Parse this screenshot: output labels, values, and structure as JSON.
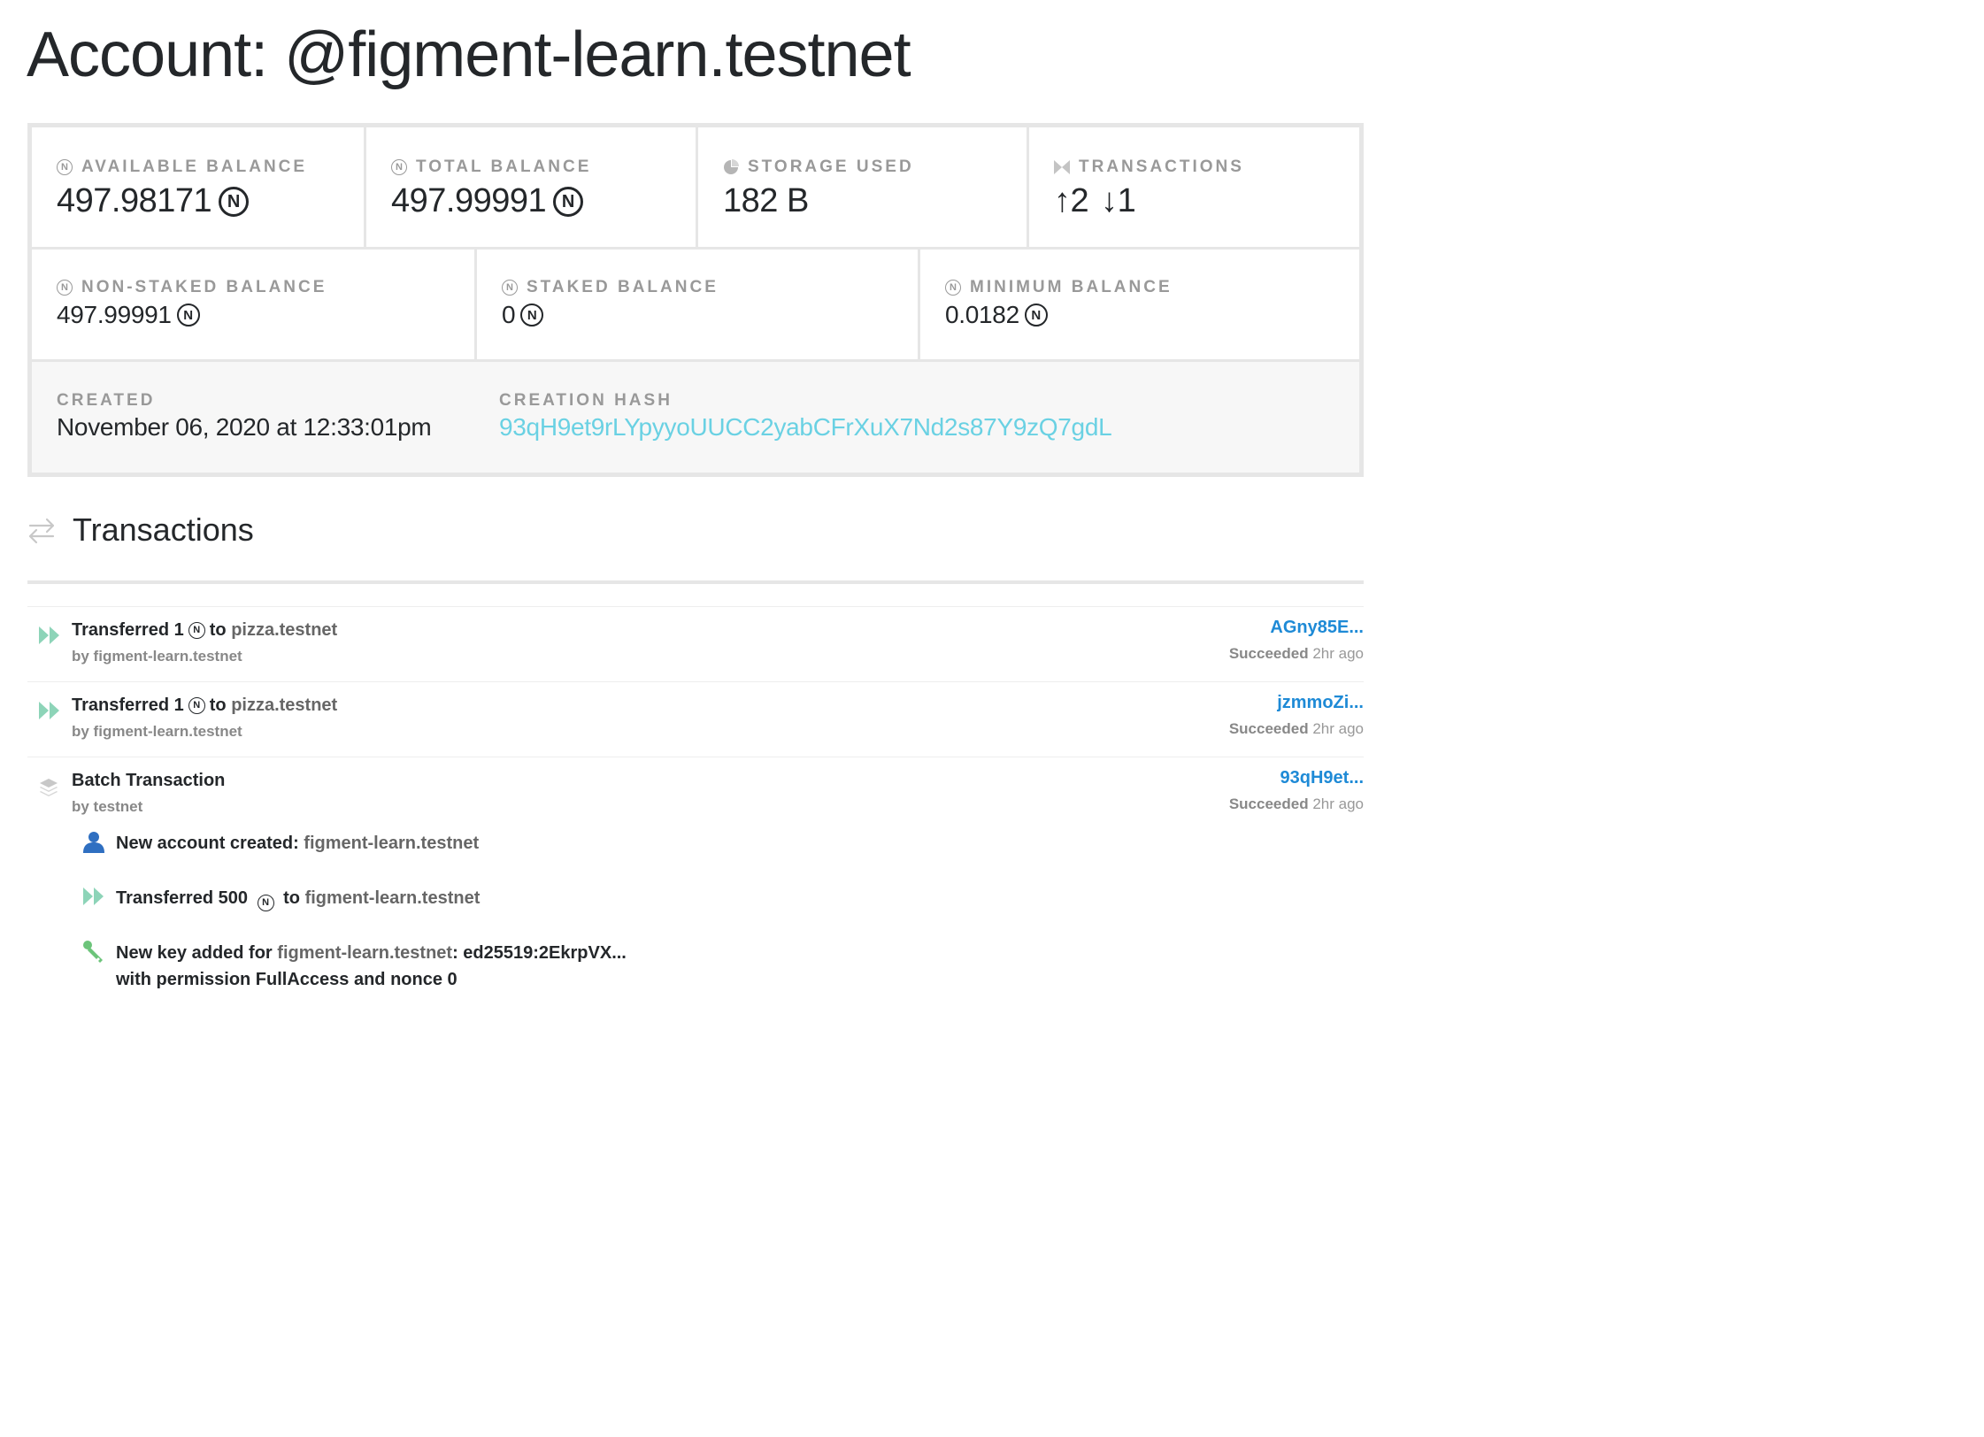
{
  "page": {
    "title": "Account: @figment-learn.testnet"
  },
  "stats": {
    "available": {
      "label": "AVAILABLE BALANCE",
      "value": "497.98171"
    },
    "total": {
      "label": "TOTAL BALANCE",
      "value": "497.99991"
    },
    "storage": {
      "label": "STORAGE USED",
      "value": "182 B"
    },
    "transactions": {
      "label": "TRANSACTIONS",
      "out_arrow": "↑",
      "out_count": "2",
      "in_arrow": "↓",
      "in_count": "1"
    },
    "non_staked": {
      "label": "NON-STAKED BALANCE",
      "value": "497.99991"
    },
    "staked": {
      "label": "STAKED BALANCE",
      "value": "0"
    },
    "minimum": {
      "label": "MINIMUM BALANCE",
      "value": "0.0182"
    },
    "created": {
      "label": "CREATED",
      "value": "November 06, 2020 at 12:33:01pm"
    },
    "creation_hash": {
      "label": "CREATION HASH",
      "value": "93qH9et9rLYpyyoUUCC2yabCFrXuX7Nd2s87Y9zQ7gdL"
    },
    "near_symbol": "N"
  },
  "transactions_section": {
    "heading": "Transactions"
  },
  "transactions": [
    {
      "title_prefix": "Transferred 1",
      "title_mid": "to",
      "account": "pizza.testnet",
      "by": "by figment-learn.testnet",
      "hash": "AGny85E...",
      "status": "Succeeded",
      "time": "2hr ago",
      "icon": "double-play-icon"
    },
    {
      "title_prefix": "Transferred 1",
      "title_mid": "to",
      "account": "pizza.testnet",
      "by": "by figment-learn.testnet",
      "hash": "jzmmoZi...",
      "status": "Succeeded",
      "time": "2hr ago",
      "icon": "double-play-icon"
    },
    {
      "title": "Batch Transaction",
      "by": "by testnet",
      "hash": "93qH9et...",
      "status": "Succeeded",
      "time": "2hr ago",
      "icon": "layers-icon",
      "actions": [
        {
          "text": "New account created:",
          "account": "figment-learn.testnet",
          "icon": "user-icon"
        },
        {
          "text_prefix": "Transferred 500",
          "text_mid": "to",
          "account": "figment-learn.testnet",
          "icon": "double-play-icon"
        },
        {
          "text_prefix": "New key added for",
          "account": "figment-learn.testnet",
          "text_suffix": ": ed25519:2EkrpVX...",
          "line2": "with permission FullAccess and nonce 0",
          "icon": "key-icon"
        }
      ]
    }
  ],
  "colors": {
    "link_blue": "#1e8ad6",
    "hash_cyan": "#6ad1e3",
    "play_green": "#8dd4b8",
    "user_blue": "#2f6fc1",
    "key_green": "#6cc47a"
  }
}
